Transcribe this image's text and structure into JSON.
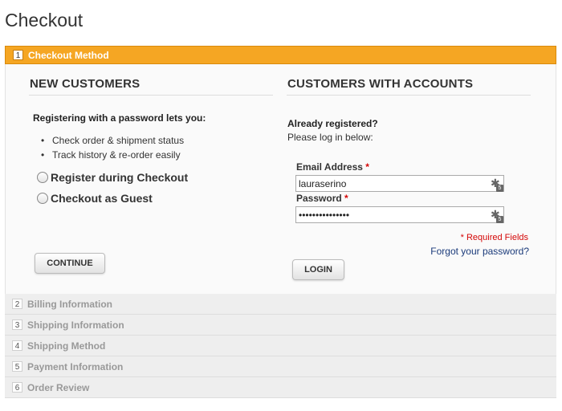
{
  "page": {
    "title": "Checkout"
  },
  "active_step": {
    "number": "1",
    "title": "Checkout Method"
  },
  "new_customers": {
    "heading": "NEW CUSTOMERS",
    "intro": "Registering with a password lets you:",
    "benefits": [
      "Check order & shipment status",
      "Track history & re-order easily"
    ],
    "options": [
      {
        "label": "Register during Checkout",
        "selected": false
      },
      {
        "label": "Checkout as Guest",
        "selected": false
      }
    ],
    "continue_label": "CONTINUE"
  },
  "returning_customers": {
    "heading": "CUSTOMERS WITH ACCOUNTS",
    "already_registered": "Already registered?",
    "login_prompt": "Please log in below:",
    "email_label": "Email Address",
    "email_value": "lauraserino",
    "password_label": "Password",
    "password_value": "•••••••••••••••",
    "required_star": "*",
    "password_manager_icon": "key-icon",
    "password_manager_badge": "5",
    "required_note": "* Required Fields",
    "forgot_password": "Forgot your password?",
    "login_label": "LOGIN"
  },
  "collapsed_steps": [
    {
      "number": "2",
      "title": "Billing Information"
    },
    {
      "number": "3",
      "title": "Shipping Information"
    },
    {
      "number": "4",
      "title": "Shipping Method"
    },
    {
      "number": "5",
      "title": "Payment Information"
    },
    {
      "number": "6",
      "title": "Order Review"
    }
  ],
  "colors": {
    "active_header": "#f5a623",
    "required": "#d40707",
    "link": "#1a3a7a",
    "collapsed_bg": "#eeeeee"
  }
}
